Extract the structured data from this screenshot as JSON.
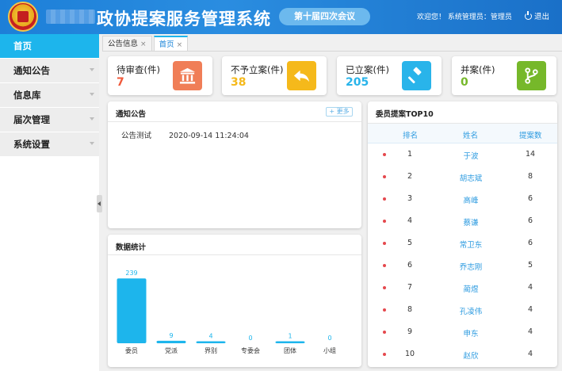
{
  "header": {
    "title": "政协提案服务管理系统",
    "session": "第十届四次会议",
    "welcome": "欢迎您！ 系统管理员：管理员",
    "logout": "退出"
  },
  "sidebar": {
    "items": [
      {
        "label": "首页",
        "active": true
      },
      {
        "label": "通知公告"
      },
      {
        "label": "信息库"
      },
      {
        "label": "届次管理"
      },
      {
        "label": "系统设置"
      }
    ]
  },
  "tabs": [
    {
      "label": "公告信息",
      "active": false
    },
    {
      "label": "首页",
      "active": true
    }
  ],
  "stats": [
    {
      "label": "待审查(件)",
      "value": "7",
      "color": "#f05a3b",
      "icon_bg": "#f07e57",
      "icon": "bank-icon"
    },
    {
      "label": "不予立案(件)",
      "value": "38",
      "color": "#f5b91b",
      "icon_bg": "#f5b91b",
      "icon": "reply-icon"
    },
    {
      "label": "已立案(件)",
      "value": "205",
      "color": "#29b4ea",
      "icon_bg": "#29b4ea",
      "icon": "gavel-icon"
    },
    {
      "label": "并案(件)",
      "value": "0",
      "color": "#76b82a",
      "icon_bg": "#76b82a",
      "icon": "merge-icon"
    }
  ],
  "notice": {
    "title": "通知公告",
    "more": "+ 更多",
    "items": [
      {
        "title": "公告测试",
        "time": "2020-09-14 11:24:04"
      }
    ]
  },
  "stats_panel": {
    "title": "数据统计"
  },
  "chart_data": {
    "type": "bar",
    "categories": [
      "委员",
      "党派",
      "界别",
      "专委会",
      "团体",
      "小组"
    ],
    "values": [
      239,
      9,
      4,
      0,
      1,
      0
    ],
    "bar_color": "#1db5ec",
    "ylim": [
      0,
      260
    ],
    "grid": false,
    "title": ""
  },
  "top10": {
    "title": "委员提案TOP10",
    "headers": [
      "排名",
      "姓名",
      "提案数"
    ],
    "rows": [
      {
        "rank": "1",
        "name": "于波",
        "count": "14"
      },
      {
        "rank": "2",
        "name": "胡志斌",
        "count": "8"
      },
      {
        "rank": "3",
        "name": "高峰",
        "count": "6"
      },
      {
        "rank": "4",
        "name": "蔡谦",
        "count": "6"
      },
      {
        "rank": "5",
        "name": "常卫东",
        "count": "6"
      },
      {
        "rank": "6",
        "name": "乔志刚",
        "count": "5"
      },
      {
        "rank": "7",
        "name": "蔺煜",
        "count": "4"
      },
      {
        "rank": "8",
        "name": "孔凌伟",
        "count": "4"
      },
      {
        "rank": "9",
        "name": "申东",
        "count": "4"
      },
      {
        "rank": "10",
        "name": "赵欣",
        "count": "4"
      }
    ]
  }
}
